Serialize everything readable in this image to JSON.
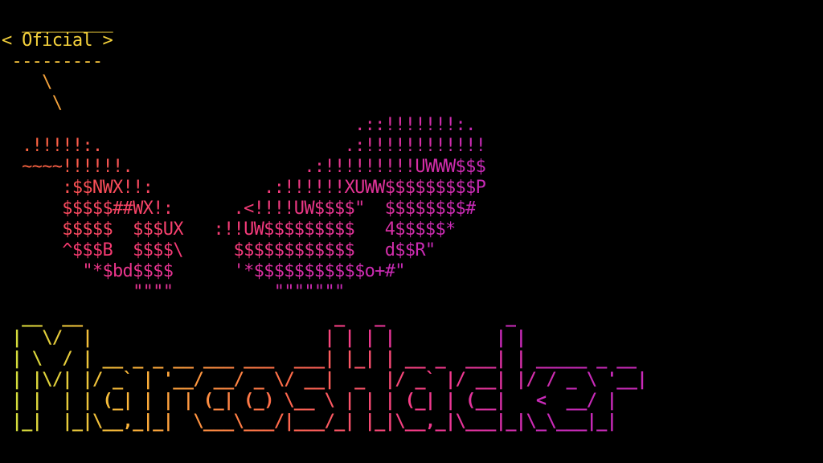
{
  "terminal": {
    "speech_bubble": {
      "top_border": "  _________",
      "text": "< Oficial >",
      "bottom_border": " ---------"
    },
    "connector": [
      "    \\",
      "     \\"
    ],
    "ascii_art": [
      "                                   .::!!!!!!!:.",
      "  .!!!!!:.                        .:!!!!!!!!!!!!",
      "  ~~~~!!!!!!.                 .:!!!!!!!!!UWWW$$$",
      "      :$$NWX!!:           .:!!!!!!XUWW$$$$$$$$$P",
      "      $$$$$##WX!:      .<!!!!UW$$$$\"  $$$$$$$$#",
      "      $$$$$  $$$UX   :!!UW$$$$$$$$$   4$$$$$*",
      "      ^$$$B  $$$$\\     $$$$$$$$$$$$   d$$R\"",
      "        \"*$bd$$$$      '*$$$$$$$$$$$o+#\"",
      "             \"\"\"\"          \"\"\"\"\"\"\""
    ],
    "banner_lines": [
      "  __  __                         _   _            _",
      " |  \\/  |                       | | | |          | |",
      " | \\  / | __ _ _ __ ___ ___  ___| |_| | __ _  ___| | _____ _ __",
      " | |\\/| |/ _` | '__/ __/ _ \\/ __|  _  |/ _` |/ __| |/ / _ \\ '__|",
      " | |  | | (_| | | | (_| (_) \\__ \\ | | | (_| | (__|   <  __/ |",
      " |_|  |_|\\__,_|_|  \\___\\___/|___/_| |_|\\__,_|\\___|_|\\_\\___|_|"
    ]
  },
  "colors": {
    "background": "#000000",
    "bubble": "#f5d23c",
    "connector": "#f5a33c",
    "art_gradient": [
      "#ff6a3a",
      "#ff4f55",
      "#f53a7a",
      "#e0309a",
      "#c82ab8"
    ],
    "banner_gradient": [
      "#cfe23c",
      "#ffb23a",
      "#ff6a4a",
      "#f53a8a",
      "#c82ab8"
    ]
  }
}
